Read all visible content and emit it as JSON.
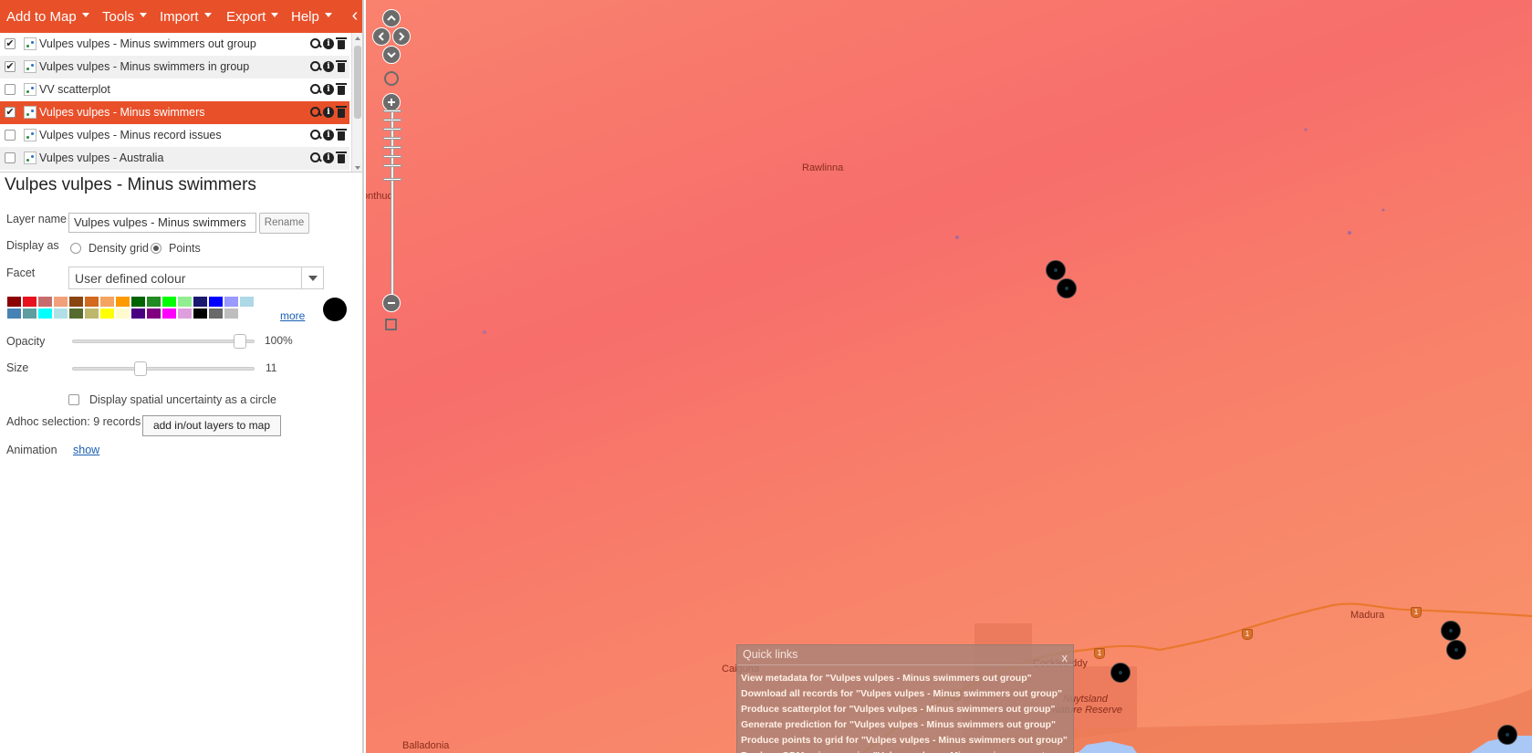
{
  "menubar": {
    "items": [
      "Add to Map",
      "Tools",
      "Import",
      "Export",
      "Help"
    ],
    "collapse_glyph": "‹"
  },
  "layers": [
    {
      "label": "Vulpes vulpes - Minus swimmers out group",
      "checked": true,
      "selected": false
    },
    {
      "label": "Vulpes vulpes - Minus swimmers in group",
      "checked": true,
      "selected": false
    },
    {
      "label": "VV scatterplot",
      "checked": false,
      "selected": false
    },
    {
      "label": "Vulpes vulpes - Minus swimmers",
      "checked": true,
      "selected": true
    },
    {
      "label": "Vulpes vulpes - Minus record issues",
      "checked": false,
      "selected": false
    },
    {
      "label": "Vulpes vulpes - Australia",
      "checked": false,
      "selected": false
    }
  ],
  "details": {
    "title": "Vulpes vulpes - Minus swimmers",
    "layer_name_label": "Layer name",
    "layer_name_value": "Vulpes vulpes - Minus swimmers",
    "rename_label": "Rename",
    "display_as_label": "Display as",
    "display_options": [
      "Density grid",
      "Points"
    ],
    "display_selected": "Points",
    "facet_label": "Facet",
    "facet_value": "User defined colour",
    "swatches_row1": [
      "#8b0000",
      "#e8111d",
      "#c76d6d",
      "#f1a07a",
      "#8a4513",
      "#d2691e",
      "#f4a460",
      "#ff9900",
      "#006400",
      "#228b22",
      "#00ff00",
      "#90ee90",
      "#191970",
      "#0000ff",
      "#9999ff",
      "#add8e6"
    ],
    "swatches_row2": [
      "#4682b4",
      "#5f9ea0",
      "#00ffff",
      "#b0e0e6",
      "#556b2f",
      "#bdb76b",
      "#ffff00",
      "#fffacd",
      "#4b0082",
      "#800080",
      "#ff00ff",
      "#dda0dd",
      "#000000",
      "#696969",
      "#bebebe"
    ],
    "more_label": "more",
    "current_colour": "#000000",
    "opacity_label": "Opacity",
    "opacity_value": "100%",
    "opacity_fraction": 1.0,
    "size_label": "Size",
    "size_value": "11",
    "size_fraction": 0.36,
    "uncertainty_label": "Display spatial uncertainty as a circle",
    "adhoc_label": "Adhoc selection: 9 records",
    "adhoc_button": "add in/out layers to map",
    "animation_label": "Animation",
    "animation_link": "show"
  },
  "map": {
    "place_labels": [
      "Rawlinna",
      "onthuc",
      "Madura",
      "Cocklebiddy",
      "Nuytsland",
      "Nature Reserve",
      "Caiguna",
      "Balladonia"
    ],
    "route_shield_text": "1",
    "colors": {
      "accent": "#e8502a",
      "road": "#e9782e",
      "water": "#a9c8f5",
      "heat_hot": "#f76e6b",
      "heat_warm": "#f9956a"
    }
  },
  "quick_links": {
    "title": "Quick links",
    "close": "x",
    "items": [
      "View metadata for \"Vulpes vulpes - Minus swimmers out group\"",
      "Download all records for \"Vulpes vulpes - Minus swimmers out group\"",
      "Produce scatterplot for \"Vulpes vulpes - Minus swimmers out group\"",
      "Generate prediction for \"Vulpes vulpes - Minus swimmers out group\"",
      "Produce points to grid for \"Vulpes vulpes - Minus swimmers out group\"",
      "Produce GDM using species \"Vulpes vulpes - Minus swimmers out group\""
    ]
  }
}
